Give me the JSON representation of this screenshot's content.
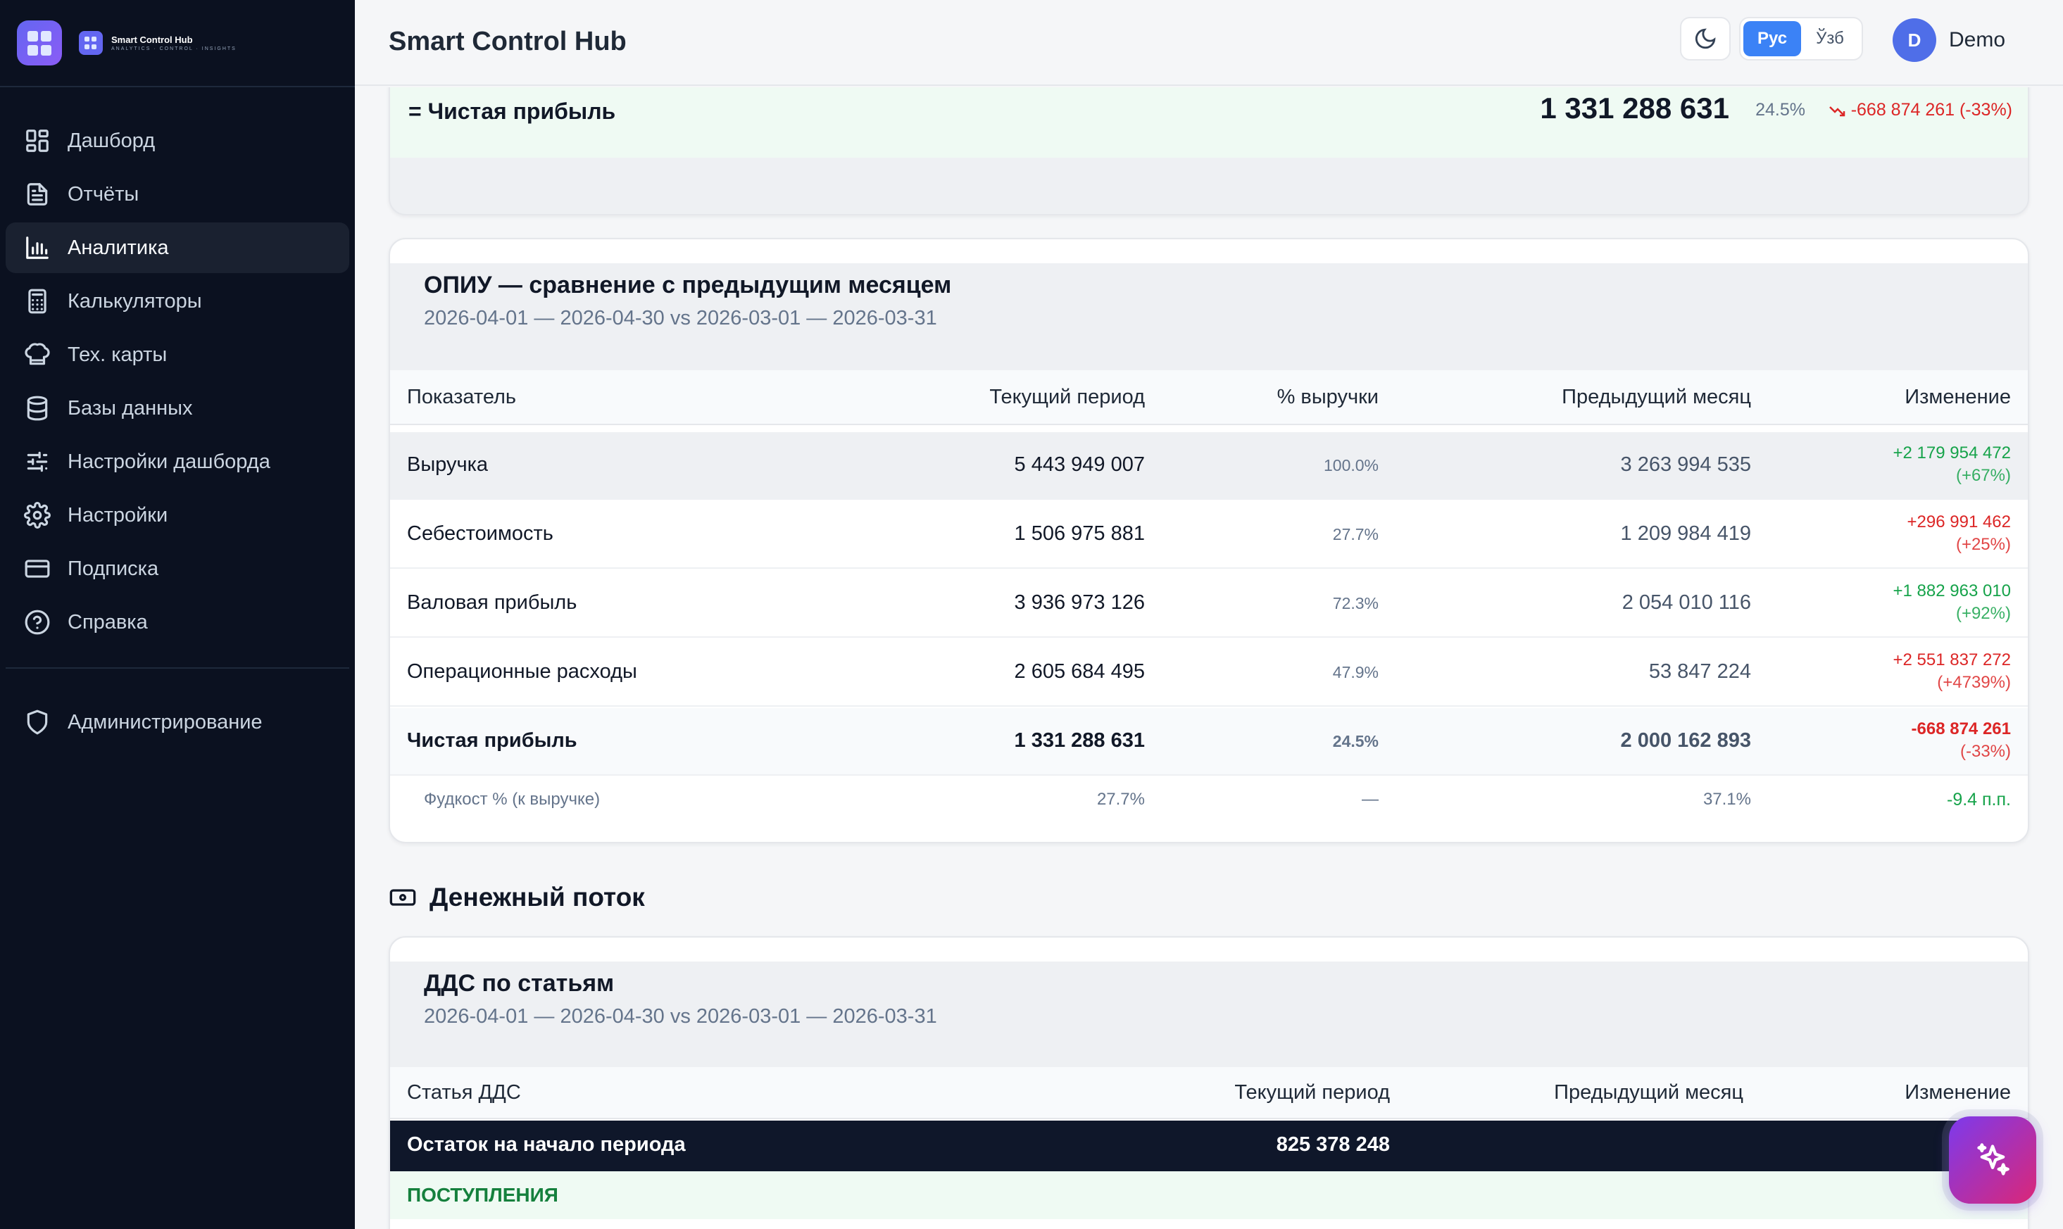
{
  "brand": {
    "name": "Smart Control Hub",
    "tagline": "ANALYTICS · CONTROL · INSIGHTS"
  },
  "sidebar": {
    "items": [
      {
        "label": "Дашборд",
        "icon": "dashboard-icon"
      },
      {
        "label": "Отчёты",
        "icon": "reports-icon"
      },
      {
        "label": "Аналитика",
        "icon": "analytics-icon",
        "active": true
      },
      {
        "label": "Калькуляторы",
        "icon": "calculator-icon"
      },
      {
        "label": "Тех. карты",
        "icon": "chef-hat-icon"
      },
      {
        "label": "Базы данных",
        "icon": "database-icon"
      },
      {
        "label": "Настройки дашборда",
        "icon": "sliders-icon"
      },
      {
        "label": "Настройки",
        "icon": "gear-icon"
      },
      {
        "label": "Подписка",
        "icon": "credit-card-icon"
      },
      {
        "label": "Справка",
        "icon": "help-icon"
      }
    ],
    "admin": {
      "label": "Администрирование",
      "icon": "shield-icon"
    }
  },
  "header": {
    "title": "Smart Control Hub",
    "lang": [
      "Рус",
      "Ўзб"
    ],
    "active_lang": "Рус",
    "avatar_initial": "D",
    "user": "Demo"
  },
  "net_profit": {
    "label": "= Чистая прибыль",
    "value": "1 331 288 631",
    "pct": "24.5%",
    "change": "-668 874 261 (-33%)"
  },
  "opiu": {
    "title": "ОПИУ — сравнение с предыдущим месяцем",
    "period": "2026-04-01 — 2026-04-30 vs 2026-03-01 — 2026-03-31",
    "columns": [
      "Показатель",
      "Текущий период",
      "% выручки",
      "Предыдущий месяц",
      "Изменение"
    ],
    "rows": [
      {
        "name": "Выручка",
        "current": "5 443 949 007",
        "pct": "100.0%",
        "prev": "3 263 994 535",
        "change": "+2 179 954 472",
        "change_pct": "(+67%)",
        "trend": "pos"
      },
      {
        "name": "Себестоимость",
        "current": "1 506 975 881",
        "pct": "27.7%",
        "prev": "1 209 984 419",
        "change": "+296 991 462",
        "change_pct": "(+25%)",
        "trend": "neg"
      },
      {
        "name": "Валовая прибыль",
        "current": "3 936 973 126",
        "pct": "72.3%",
        "prev": "2 054 010 116",
        "change": "+1 882 963 010",
        "change_pct": "(+92%)",
        "trend": "pos"
      },
      {
        "name": "Операционные расходы",
        "current": "2 605 684 495",
        "pct": "47.9%",
        "prev": "53 847 224",
        "change": "+2 551 837 272",
        "change_pct": "(+4739%)",
        "trend": "neg"
      },
      {
        "name": "Чистая прибыль",
        "current": "1 331 288 631",
        "pct": "24.5%",
        "prev": "2 000 162 893",
        "change": "-668 874 261",
        "change_pct": "(-33%)",
        "trend": "neg"
      }
    ],
    "foodcost": {
      "name": "Фудкост % (к выручке)",
      "current": "27.7%",
      "pct": "—",
      "prev": "37.1%",
      "change": "-9.4 п.п."
    }
  },
  "cashflow": {
    "section_title": "Денежный поток",
    "title": "ДДС по статьям",
    "period": "2026-04-01 — 2026-04-30 vs 2026-03-01 — 2026-03-31",
    "columns": [
      "Статья ДДС",
      "Текущий период",
      "Предыдущий месяц",
      "Изменение"
    ],
    "opening": {
      "label": "Остаток на начало периода",
      "value": "825 378 248"
    },
    "inflows_label": "ПОСТУПЛЕНИЯ"
  },
  "colors": {
    "positive": "#16a34a",
    "negative": "#dc2626",
    "accent": "#3b82f6",
    "sidebar_bg": "#0b1120"
  }
}
